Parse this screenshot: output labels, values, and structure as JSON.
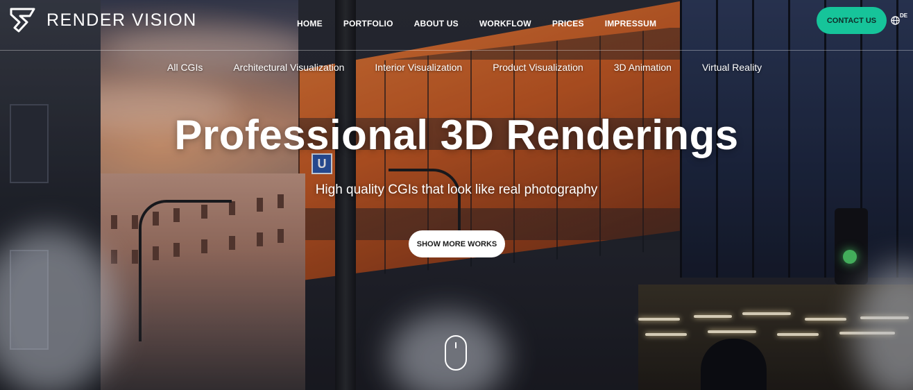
{
  "brand": {
    "name": "RENDER VISION",
    "logo_icon": "render-vision-logo-icon"
  },
  "main_nav": [
    {
      "label": "HOME"
    },
    {
      "label": "PORTFOLIO"
    },
    {
      "label": "ABOUT US"
    },
    {
      "label": "WORKFLOW"
    },
    {
      "label": "PRICES"
    },
    {
      "label": "IMPRESSUM"
    }
  ],
  "contact_button": {
    "label": "CONTACT US",
    "color": "#16c49a"
  },
  "language": {
    "icon": "globe-icon",
    "label": "DE"
  },
  "categories": [
    {
      "label": "All CGIs"
    },
    {
      "label": "Architectural Visualization"
    },
    {
      "label": "Interior Visualization"
    },
    {
      "label": "Product Visualization"
    },
    {
      "label": "3D Animation"
    },
    {
      "label": "Virtual Reality"
    }
  ],
  "hero": {
    "title": "Professional 3D Renderings",
    "subtitle": "High quality CGIs that look like real photography",
    "cta_label": "SHOW MORE WORKS",
    "scroll_icon": "mouse-scroll-icon",
    "sign_label": "U"
  }
}
